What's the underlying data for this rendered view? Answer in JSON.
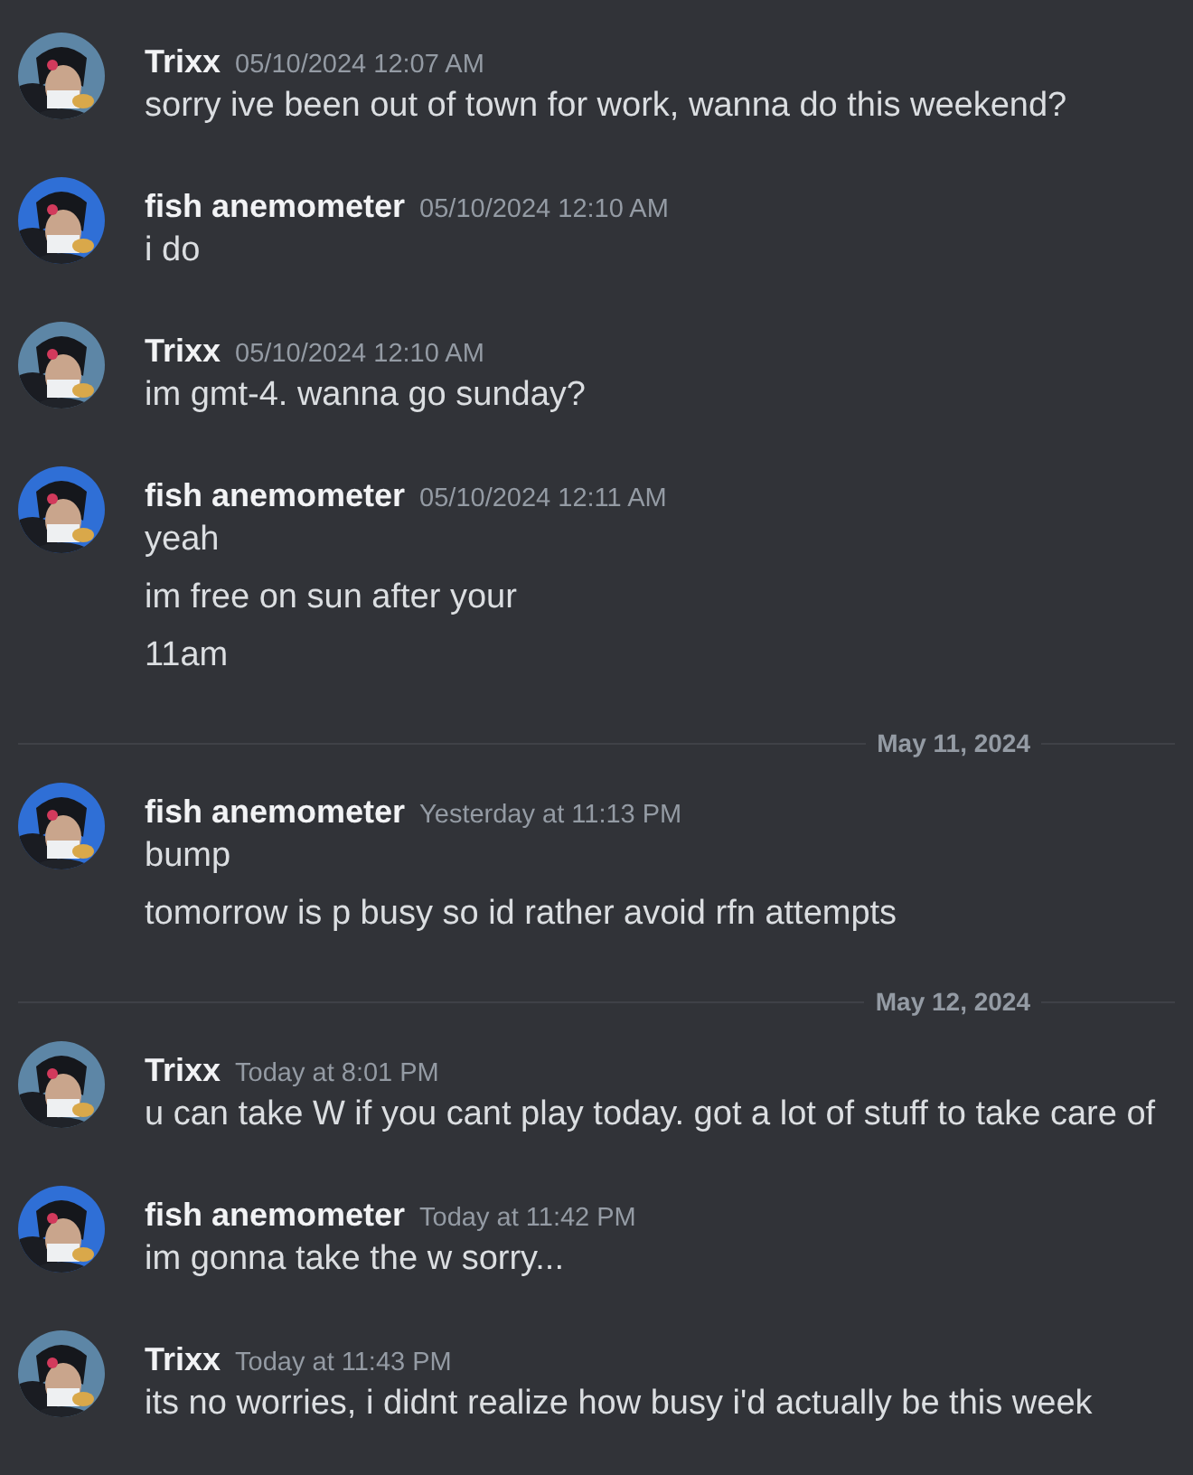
{
  "messages": [
    {
      "kind": "group",
      "author": "Trixx",
      "timestamp": "05/10/2024 12:07 AM",
      "avatar": {
        "kind": "picture",
        "color": "#5d86a6"
      },
      "lines": [
        "sorry ive been out of town for work, wanna do this weekend?"
      ]
    },
    {
      "kind": "group",
      "author": "fish anemometer",
      "timestamp": "05/10/2024 12:10 AM",
      "avatar": {
        "kind": "picture",
        "color": "#2f6fd6"
      },
      "lines": [
        "i do"
      ]
    },
    {
      "kind": "group",
      "author": "Trixx",
      "timestamp": "05/10/2024 12:10 AM",
      "avatar": {
        "kind": "picture",
        "color": "#5d86a6"
      },
      "lines": [
        "im gmt-4. wanna go sunday?"
      ]
    },
    {
      "kind": "group",
      "author": "fish anemometer",
      "timestamp": "05/10/2024 12:11 AM",
      "avatar": {
        "kind": "picture",
        "color": "#2f6fd6"
      },
      "lines": [
        "yeah",
        "im free on sun after your",
        "11am"
      ]
    },
    {
      "kind": "divider",
      "label": "May 11, 2024"
    },
    {
      "kind": "group",
      "author": "fish anemometer",
      "timestamp": "Yesterday at 11:13 PM",
      "avatar": {
        "kind": "picture",
        "color": "#2f6fd6"
      },
      "lines": [
        "bump",
        "tomorrow is p busy so id rather avoid rfn attempts"
      ]
    },
    {
      "kind": "divider",
      "label": "May 12, 2024"
    },
    {
      "kind": "group",
      "author": "Trixx",
      "timestamp": "Today at 8:01 PM",
      "avatar": {
        "kind": "picture",
        "color": "#5d86a6"
      },
      "lines": [
        "u can take W if you cant play today. got a lot of stuff to take care of"
      ]
    },
    {
      "kind": "group",
      "author": "fish anemometer",
      "timestamp": "Today at 11:42 PM",
      "avatar": {
        "kind": "picture",
        "color": "#2f6fd6"
      },
      "lines": [
        "im gonna take the w sorry..."
      ]
    },
    {
      "kind": "group",
      "author": "Trixx",
      "timestamp": "Today at 11:43 PM",
      "avatar": {
        "kind": "picture",
        "color": "#5d86a6"
      },
      "lines": [
        "its no worries, i didnt realize how busy i'd actually be this week"
      ]
    }
  ]
}
